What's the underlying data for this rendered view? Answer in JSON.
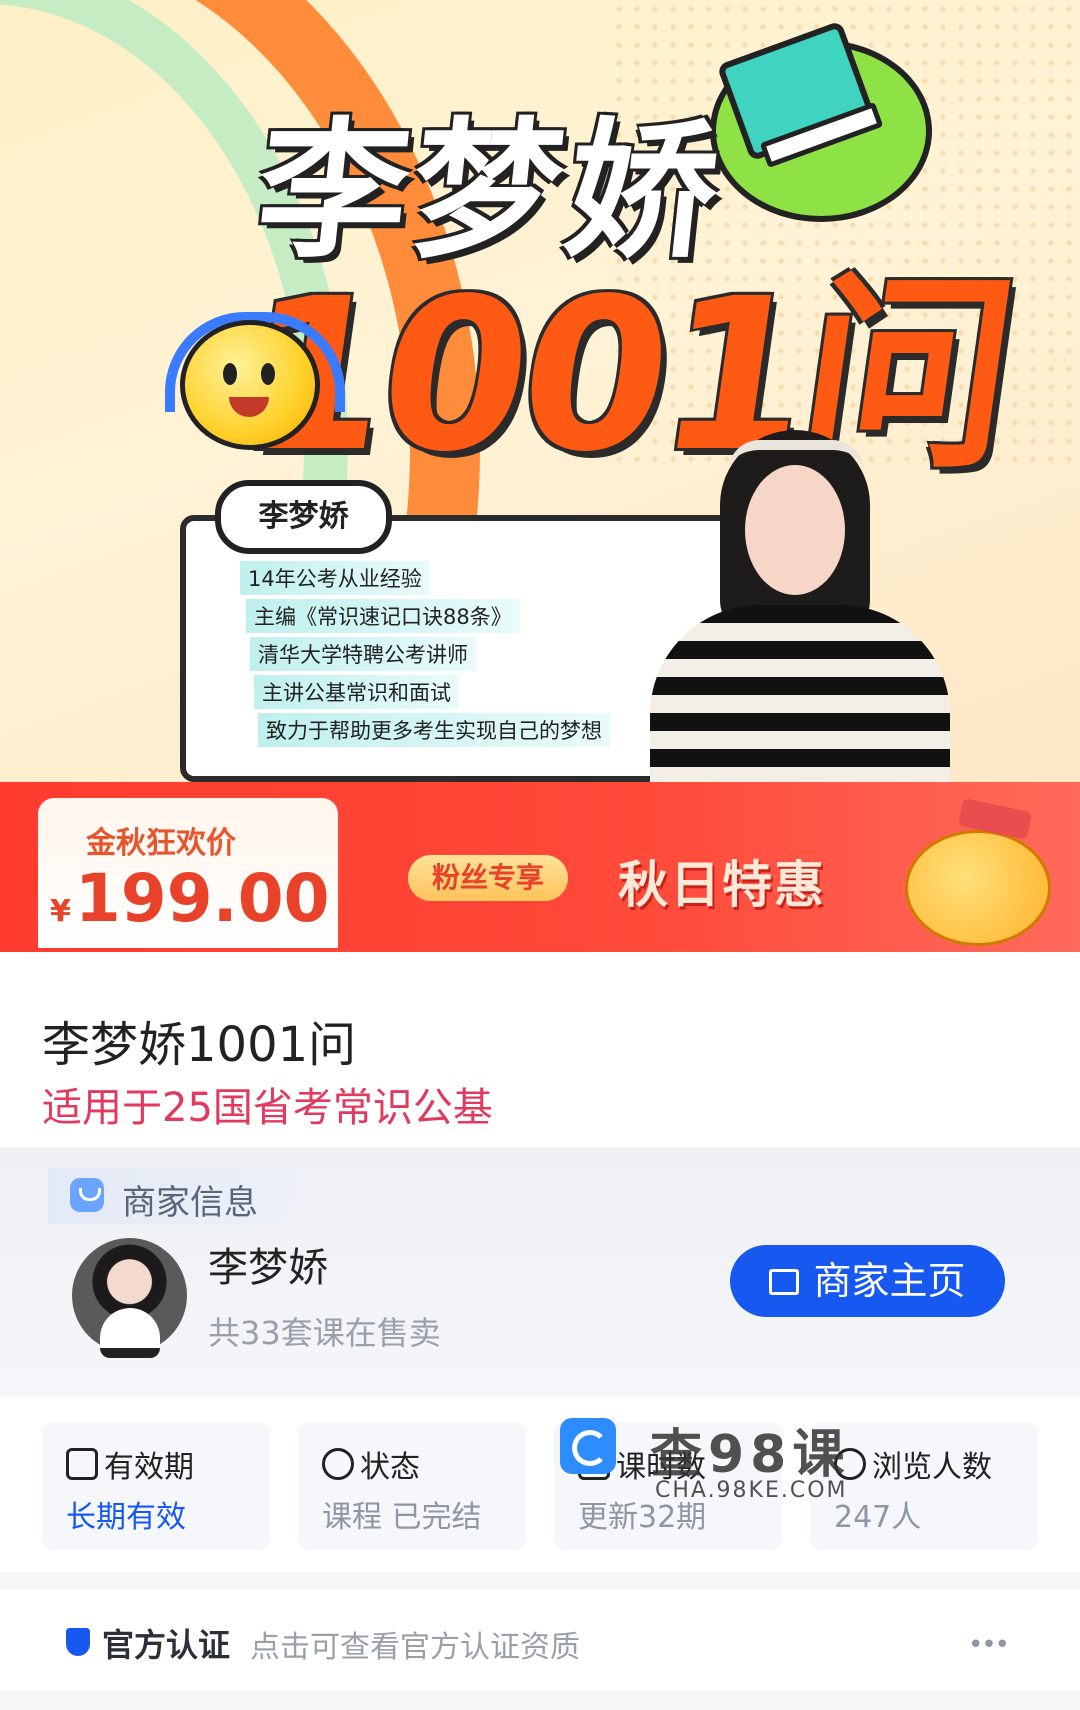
{
  "banner": {
    "title_name": "李梦娇",
    "title_number": "1001问",
    "name_tag": "李梦娇",
    "info_lines": [
      "14年公考从业经验",
      "主编《常识速记口诀88条》",
      "清华大学特聘公考讲师",
      "主讲公基常识和面试",
      "致力于帮助更多考生实现自己的梦想"
    ],
    "price_label": "金秋狂欢价",
    "price_currency": "¥",
    "price_value": "199.00",
    "fans_tag": "粉丝专享",
    "promo_text": "秋日特惠"
  },
  "course": {
    "title": "李梦娇1001问",
    "subtitle": "适用于25国省考常识公基"
  },
  "merchant": {
    "section_label": "商家信息",
    "name": "李梦娇",
    "course_count": "共33套课在售卖",
    "home_button": "商家主页"
  },
  "stats": [
    {
      "label": "有效期",
      "value": "长期有效"
    },
    {
      "label": "状态",
      "value": "课程 已完结"
    },
    {
      "label": "课时数",
      "value": "更新32期"
    },
    {
      "label": "浏览人数",
      "value": "247人"
    }
  ],
  "watermark": {
    "text": "查98课",
    "url": "CHA.98KE.COM"
  },
  "official": {
    "title": "官方认证",
    "desc": "点击可查看官方认证资质",
    "more_icon": "•••"
  },
  "colors": {
    "accent_blue": "#1658f0",
    "subtitle_pink": "#e23a5e",
    "promo_red": "#ff3b2f"
  }
}
